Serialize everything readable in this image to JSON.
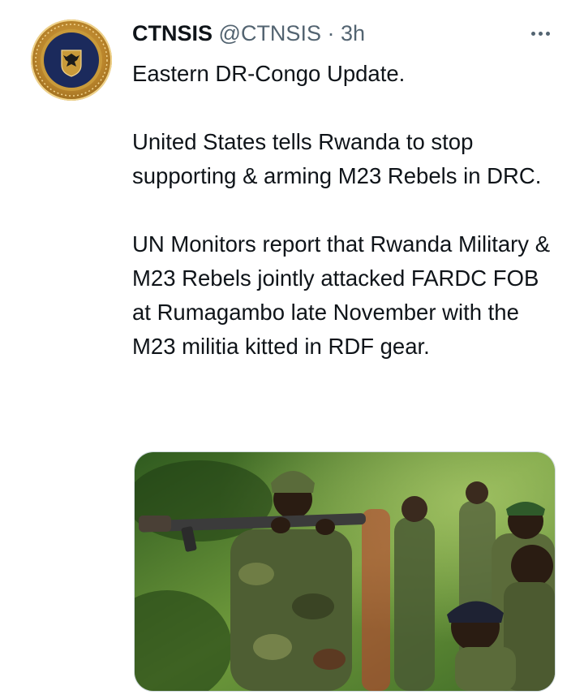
{
  "tweet": {
    "display_name": "CTNSIS",
    "handle": "@CTNSIS",
    "separator": "·",
    "time": "3h",
    "paragraphs": [
      "Eastern DR-Congo Update.",
      "United States tells Rwanda to stop supporting & arming M23 Rebels in DRC.",
      "UN Monitors report that Rwanda Military & M23 Rebels jointly attacked FARDC FOB at Rumagambo late November with the M23 militia kitted in RDF gear."
    ]
  },
  "icons": {
    "more": "more-options-icon"
  },
  "colors": {
    "text_primary": "#0f1419",
    "text_secondary": "#536471",
    "avatar_gold": "#c99a3a",
    "avatar_navy": "#1b2a5c"
  }
}
